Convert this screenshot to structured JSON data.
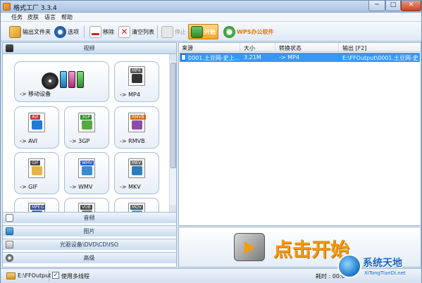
{
  "window": {
    "title": "格式工厂 3.3.4",
    "controls": {
      "minimize": "─",
      "maximize": "□",
      "close": "✕"
    }
  },
  "menu": [
    "任务",
    "皮肤",
    "语言",
    "帮助"
  ],
  "toolbar": {
    "output_folder": "输出文件夹",
    "options": "选项",
    "remove": "移除",
    "clear_list": "清空列表",
    "stop": "停止",
    "start": "开始",
    "wps": "WPS办公软件"
  },
  "categories": {
    "video": "视频",
    "audio": "音频",
    "picture": "图片",
    "disc": "光驱设备\\DVD\\CD\\ISO",
    "advanced": "高级"
  },
  "video_formats": [
    {
      "label": "-> 移动设备"
    },
    {
      "label": "-> MP4",
      "badge": "MP4",
      "badge_color": "#555555",
      "art_color": "#333333"
    },
    {
      "label": "-> AVI",
      "badge": "AVI",
      "badge_color": "#c03030",
      "art_color": "#1e7bd8"
    },
    {
      "label": "-> 3GP",
      "badge": "3GP",
      "badge_color": "#2f8a2d",
      "art_color": "#55aa3c"
    },
    {
      "label": "-> RMVB",
      "badge": "RMVB",
      "badge_color": "#c86a16",
      "art_color": "#8a4ea8"
    },
    {
      "label": "-> GIF",
      "badge": "GIF",
      "badge_color": "#444444",
      "art_color": "#e8b24a"
    },
    {
      "label": "-> WMV",
      "badge": "WMV",
      "badge_color": "#2060b8",
      "art_color": "#3a8ad4"
    },
    {
      "label": "-> MKV",
      "badge": "MKV",
      "badge_color": "#666666",
      "art_color": "#2a7fb8"
    },
    {
      "label": "",
      "badge": "MPEG",
      "badge_color": "#2d4f8a",
      "art_color": "#3a5fa8"
    },
    {
      "label": "",
      "badge": "VOB",
      "badge_color": "#444444",
      "art_color": "#6a6a6a"
    },
    {
      "label": "",
      "badge": "MOV",
      "badge_color": "#555555",
      "art_color": "#4a90c2"
    }
  ],
  "task_columns": {
    "source": "来源",
    "size": "大小",
    "status": "转换状态",
    "output": "输出 [F2]"
  },
  "tasks": [
    {
      "source": "0001.土豆网-史上...",
      "size": "3.21M",
      "status": "-> MP4",
      "output": "E:\\FFOutput\\0001.土豆网-史上..."
    }
  ],
  "banner": {
    "text": "点击开始"
  },
  "status": {
    "output_path": "E:\\FFOutput",
    "multithread_checked": "✓",
    "multithread_label": "使用多线程",
    "elapsed": "耗时 : 00:0"
  },
  "watermark": {
    "title": "系统天地",
    "subtitle": "XiTongTianDi.net"
  },
  "colors": {
    "selection": "#3399ff",
    "start_button": "#f5a623",
    "banner_text": "#f39a12",
    "watermark": "#1a66c2"
  }
}
